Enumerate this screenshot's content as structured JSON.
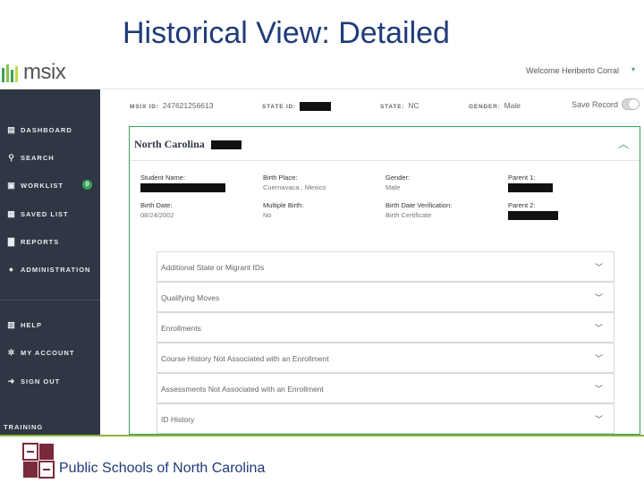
{
  "slide": {
    "title": "Historical View: Detailed"
  },
  "app": {
    "logo_text": "msix",
    "welcome": "Welcome Heriberto Corral",
    "welcome_caret": "▾"
  },
  "sidebar": {
    "items": [
      {
        "label": "DASHBOARD",
        "icon": "dashboard-icon"
      },
      {
        "label": "SEARCH",
        "icon": "search-icon"
      },
      {
        "label": "WORKLIST",
        "icon": "briefcase-icon",
        "badge": "0"
      },
      {
        "label": "SAVED LIST",
        "icon": "inbox-icon"
      },
      {
        "label": "REPORTS",
        "icon": "document-icon"
      },
      {
        "label": "ADMINISTRATION",
        "icon": "user-icon"
      },
      {
        "label": "HELP",
        "icon": "book-icon"
      },
      {
        "label": "MY ACCOUNT",
        "icon": "gear-icon"
      },
      {
        "label": "SIGN OUT",
        "icon": "sign-out-icon"
      }
    ],
    "footer": "TRAINING"
  },
  "infobar": {
    "msix_id_label": "MSIX ID:",
    "msix_id_value": "247621256613",
    "state_id_label": "STATE ID:",
    "state_label": "STATE:",
    "state_value": "NC",
    "gender_label": "GENDER:",
    "gender_value": "Male",
    "save_record": "Save Record"
  },
  "card": {
    "title": "North Carolina",
    "fields": {
      "student_name_label": "Student Name:",
      "birth_place_label": "Birth Place:",
      "birth_place_value": "Cuernavaca , Mexico",
      "gender_label": "Gender:",
      "gender_value": "Male",
      "parent1_label": "Parent 1:",
      "birth_date_label": "Birth Date:",
      "birth_date_value": "08/24/2002",
      "multiple_birth_label": "Multiple Birth:",
      "multiple_birth_value": "No",
      "birth_date_verification_label": "Birth Date Verification:",
      "birth_date_verification_value": "Birth Certificate",
      "parent2_label": "Parent 2:"
    },
    "sections": [
      "Additional State or Migrant IDs",
      "Qualifying Moves",
      "Enrollments",
      "Course History Not Associated with an Enrollment",
      "Assessments Not Associated with an Enrollment",
      "ID History"
    ]
  },
  "footer": {
    "org_name": "Public Schools of North Carolina"
  },
  "colors": {
    "accent": "#3aa35a",
    "sidebar": "#2f3644",
    "title": "#1f3b7a",
    "footer_line": "#8bb33a"
  }
}
